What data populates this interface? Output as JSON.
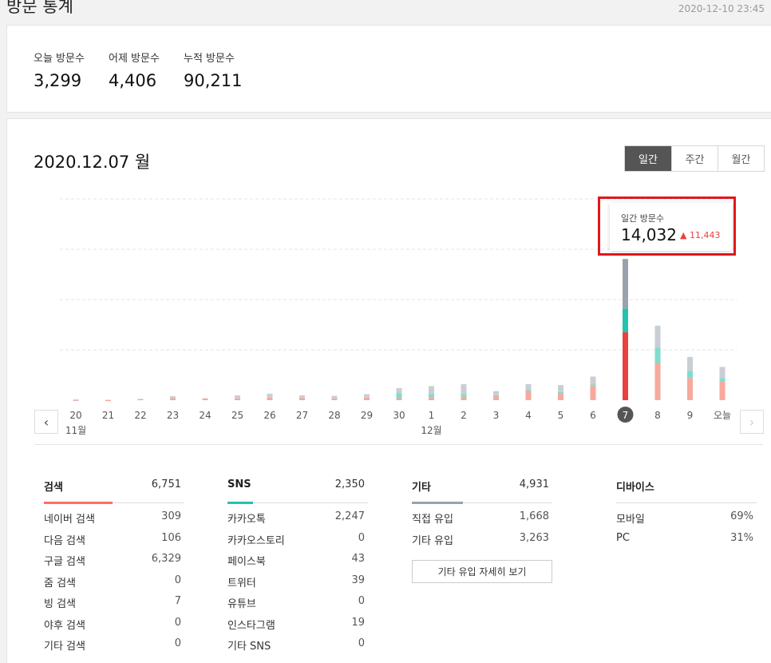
{
  "header": {
    "title": "방문 통계",
    "datetime": "2020-12-10 23:45"
  },
  "visits": [
    {
      "label": "오늘 방문수",
      "value": "3,299"
    },
    {
      "label": "어제 방문수",
      "value": "4,406"
    },
    {
      "label": "누적 방문수",
      "value": "90,211"
    }
  ],
  "main": {
    "date_heading": "2020.12.07 월",
    "tabs": [
      {
        "label": "일간",
        "active": true
      },
      {
        "label": "주간",
        "active": false
      },
      {
        "label": "월간",
        "active": false
      }
    ]
  },
  "tooltip": {
    "label": "일간 방문수",
    "value": "14,032",
    "increase": "▲ 11,443"
  },
  "colors": {
    "search": "#ff6f61",
    "search_light": "#f7a99c",
    "sns": "#25c2ae",
    "sns_light": "#7fdccf",
    "etc": "#9aa3ad",
    "etc_light": "#c9ced4",
    "selected": "#e8423f",
    "grid": "#e3e3e3"
  },
  "chart_data": {
    "type": "bar",
    "stacked": true,
    "categories": [
      "20",
      "21",
      "22",
      "23",
      "24",
      "25",
      "26",
      "27",
      "28",
      "29",
      "30",
      "1",
      "2",
      "3",
      "4",
      "5",
      "6",
      "7",
      "8",
      "9",
      "오늘"
    ],
    "month_labels": [
      {
        "category_index": 0,
        "label": "11월"
      },
      {
        "category_index": 11,
        "label": "12월"
      }
    ],
    "selected_index": 17,
    "ylim": [
      0,
      20000
    ],
    "grid": true,
    "series": [
      {
        "values": [
          40,
          30,
          120,
          200,
          180,
          180,
          250,
          230,
          180,
          250,
          200,
          300,
          350,
          400,
          950,
          700,
          1400,
          6751,
          3700,
          2200,
          1900
        ]
      },
      {
        "values": [
          0,
          0,
          0,
          0,
          0,
          0,
          0,
          0,
          0,
          0,
          500,
          300,
          250,
          100,
          100,
          100,
          150,
          2350,
          1500,
          700,
          300
        ]
      },
      {
        "values": [
          40,
          0,
          0,
          200,
          0,
          300,
          400,
          250,
          250,
          350,
          500,
          800,
          1000,
          400,
          550,
          700,
          800,
          4931,
          2200,
          1400,
          1100
        ]
      }
    ]
  },
  "stats": {
    "search": {
      "name": "검색",
      "total": "6,751",
      "items": [
        {
          "label": "네이버 검색",
          "value": "309"
        },
        {
          "label": "다음 검색",
          "value": "106"
        },
        {
          "label": "구글 검색",
          "value": "6,329"
        },
        {
          "label": "줌 검색",
          "value": "0"
        },
        {
          "label": "빙 검색",
          "value": "7"
        },
        {
          "label": "야후 검색",
          "value": "0"
        },
        {
          "label": "기타 검색",
          "value": "0"
        }
      ]
    },
    "sns": {
      "name": "SNS",
      "total": "2,350",
      "items": [
        {
          "label": "카카오톡",
          "value": "2,247"
        },
        {
          "label": "카카오스토리",
          "value": "0"
        },
        {
          "label": "페이스북",
          "value": "43"
        },
        {
          "label": "트위터",
          "value": "39"
        },
        {
          "label": "유튜브",
          "value": "0"
        },
        {
          "label": "인스타그램",
          "value": "19"
        },
        {
          "label": "기타 SNS",
          "value": "0"
        }
      ]
    },
    "etc": {
      "name": "기타",
      "total": "4,931",
      "items": [
        {
          "label": "직접 유입",
          "value": "1,668"
        },
        {
          "label": "기타 유입",
          "value": "3,263"
        }
      ],
      "detail_button": "기타 유입 자세히 보기"
    },
    "device": {
      "name": "디바이스",
      "items": [
        {
          "label": "모바일",
          "value": "69%"
        },
        {
          "label": "PC",
          "value": "31%"
        }
      ]
    }
  }
}
